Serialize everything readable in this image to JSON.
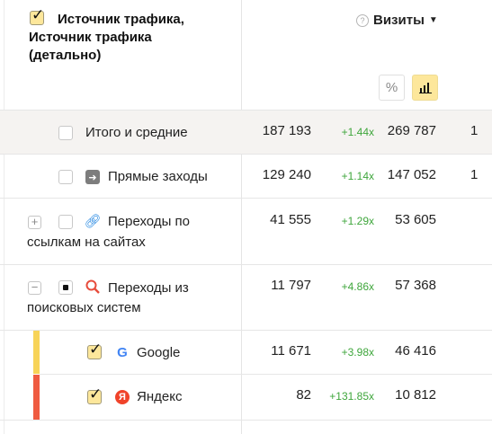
{
  "header": {
    "dimension_line1": "Источник трафика,",
    "dimension_line2": "Источник трафика",
    "dimension_line3": "(детально)",
    "metric": "Визиты",
    "help": "?",
    "sort": "▼",
    "percent_button": "%",
    "chart_button_icon": "bar-chart-icon"
  },
  "rows": [
    {
      "label": "Итого и средние",
      "visits": "187 193",
      "ratio": "+1.44x",
      "col3": "269 787",
      "col4": "1"
    },
    {
      "label": "Прямые заходы",
      "visits": "129 240",
      "ratio": "+1.14x",
      "col3": "147 052",
      "col4": "1"
    },
    {
      "label_line1": "Переходы по",
      "label_line2": "ссылкам на сайтах",
      "visits": "41 555",
      "ratio": "+1.29x",
      "col3": "53 605",
      "expander": "+"
    },
    {
      "label_line1": "Переходы из",
      "label_line2": "поисковых систем",
      "visits": "11 797",
      "ratio": "+4.86x",
      "col3": "57 368",
      "expander": "−"
    },
    {
      "label": "Google",
      "visits": "11 671",
      "ratio": "+3.98x",
      "col3": "46 416",
      "stripe_color": "#f7d358",
      "icon": "G"
    },
    {
      "label": "Яндекс",
      "visits": "82",
      "ratio": "+131.85x",
      "col3": "10 812",
      "stripe_color": "#ef5b41",
      "icon": "Я"
    }
  ]
}
